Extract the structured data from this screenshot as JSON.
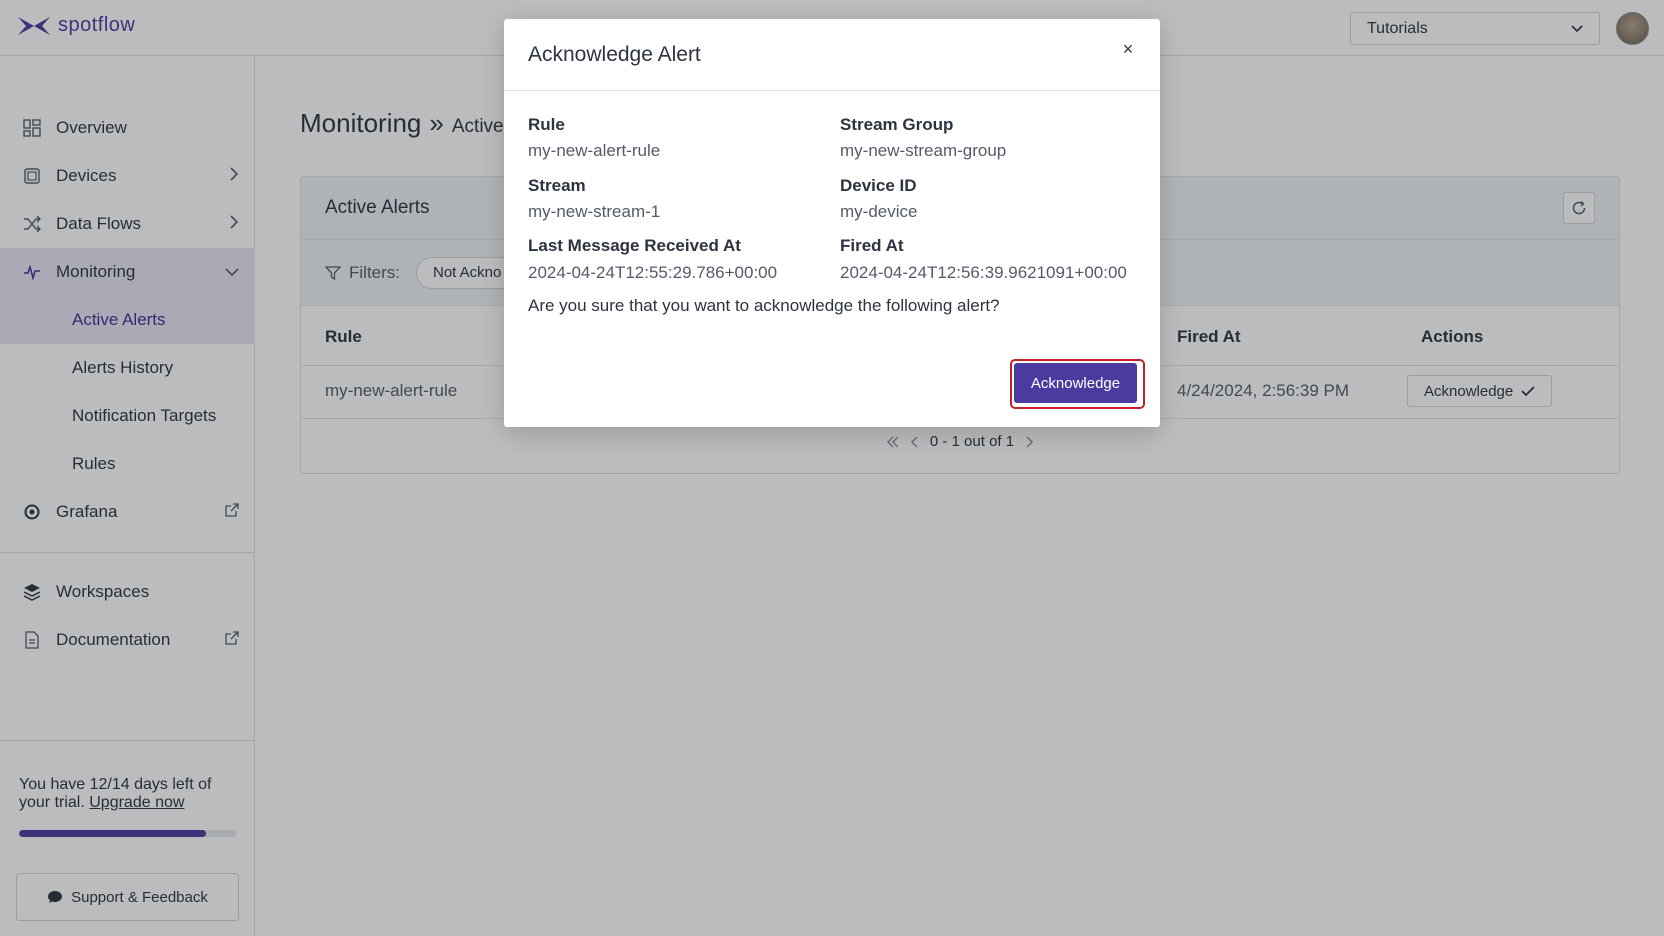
{
  "app": {
    "logo_text": "spotflow"
  },
  "topbar": {
    "workspace_selected": "Tutorials"
  },
  "sidebar": {
    "items": [
      {
        "label": "Overview",
        "icon": "grid-icon"
      },
      {
        "label": "Devices",
        "icon": "device-icon"
      },
      {
        "label": "Data Flows",
        "icon": "shuffle-icon"
      },
      {
        "label": "Monitoring",
        "icon": "pulse-icon"
      },
      {
        "label": "Grafana",
        "icon": "grafana-icon"
      },
      {
        "label": "Workspaces",
        "icon": "layers-icon"
      },
      {
        "label": "Documentation",
        "icon": "document-icon"
      }
    ],
    "monitoring_sub": [
      "Active Alerts",
      "Alerts History",
      "Notification Targets",
      "Rules"
    ],
    "trial": {
      "text": "You have 12/14 days left of your trial.",
      "link": "Upgrade now",
      "progress": 0.857
    },
    "support_label": "Support & Feedback"
  },
  "main": {
    "title": "Monitoring",
    "separator": "»",
    "subtitle": "Active",
    "panel_title": "Active Alerts",
    "filters_label": "Filters:",
    "filter_chip": "Not Ackno",
    "columns": {
      "rule": "Rule",
      "fired_at": "Fired At",
      "actions": "Actions"
    },
    "row": {
      "rule": "my-new-alert-rule",
      "fired_at": "4/24/2024, 2:56:39 PM",
      "action_label": "Acknowledge"
    },
    "pager": "0 - 1 out of 1"
  },
  "modal": {
    "title": "Acknowledge Alert",
    "close": "×",
    "fields": {
      "rule_label": "Rule",
      "rule_value": "my-new-alert-rule",
      "stream_group_label": "Stream Group",
      "stream_group_value": "my-new-stream-group",
      "stream_label": "Stream",
      "stream_value": "my-new-stream-1",
      "device_id_label": "Device ID",
      "device_id_value": "my-device",
      "last_msg_label": "Last Message Received At",
      "last_msg_value": "2024-04-24T12:55:29.786+00:00",
      "fired_at_label": "Fired At",
      "fired_at_value": "2024-04-24T12:56:39.9621091+00:00"
    },
    "question": "Are you sure that you want to acknowledge the following alert?",
    "confirm_label": "Acknowledge"
  },
  "colors": {
    "brand": "#4b3aa0",
    "focus_ring": "#c42027"
  }
}
